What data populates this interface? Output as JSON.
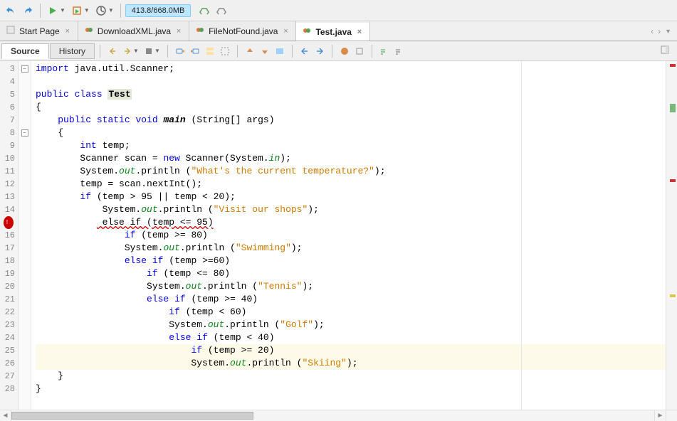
{
  "toolbar": {
    "memory": "413.8/668.0MB"
  },
  "tabs": [
    {
      "label": "Start Page",
      "icon": "start"
    },
    {
      "label": "DownloadXML.java",
      "icon": "java"
    },
    {
      "label": "FileNotFound.java",
      "icon": "java"
    },
    {
      "label": "Test.java",
      "icon": "java"
    }
  ],
  "activeTab": 3,
  "subTabs": {
    "source": "Source",
    "history": "History"
  },
  "code": {
    "lines": [
      {
        "n": 3,
        "fold": "minus",
        "html": "<span class='kw'>import</span> java.util.Scanner;"
      },
      {
        "n": 4,
        "html": ""
      },
      {
        "n": 5,
        "html": "<span class='kw'>public</span> <span class='kw'>class</span> <span class='cls'><b>Test</b></span>"
      },
      {
        "n": 6,
        "html": "{"
      },
      {
        "n": 7,
        "html": "    <span class='kw'>public</span> <span class='kw'>static</span> <span class='kw'>void</span> <span class='fn'>main</span> (String[] args)"
      },
      {
        "n": 8,
        "fold": "minus",
        "html": "    {"
      },
      {
        "n": 9,
        "html": "        <span class='kw'>int</span> temp;"
      },
      {
        "n": 10,
        "html": "        Scanner scan = <span class='kw'>new</span> Scanner(System.<span class='fld'>in</span>);"
      },
      {
        "n": 11,
        "html": "        System.<span class='fld'>out</span>.println (<span class='str'>\"What's the current temperature?\"</span>);"
      },
      {
        "n": 12,
        "html": "        temp = scan.nextInt();"
      },
      {
        "n": 13,
        "html": "        <span class='kw'>if</span> (temp &gt; 95 || temp &lt; 20);"
      },
      {
        "n": 14,
        "html": "            System.<span class='fld'>out</span>.println (<span class='str'>\"Visit our shops\"</span>);"
      },
      {
        "n": "err",
        "html": "           <span class='err'> else if (temp &lt;= 95)</span>"
      },
      {
        "n": 16,
        "html": "                <span class='kw'>if</span> (temp &gt;= 80)"
      },
      {
        "n": 17,
        "html": "                System.<span class='fld'>out</span>.println (<span class='str'>\"Swimming\"</span>);"
      },
      {
        "n": 18,
        "html": "                <span class='kw'>else</span> <span class='kw'>if</span> (temp &gt;=60)"
      },
      {
        "n": 19,
        "html": "                    <span class='kw'>if</span> (temp &lt;= 80)"
      },
      {
        "n": 20,
        "html": "                    System.<span class='fld'>out</span>.println (<span class='str'>\"Tennis\"</span>);"
      },
      {
        "n": 21,
        "html": "                    <span class='kw'>else</span> <span class='kw'>if</span> (temp &gt;= 40)"
      },
      {
        "n": 22,
        "html": "                        <span class='kw'>if</span> (temp &lt; 60)"
      },
      {
        "n": 23,
        "html": "                        System.<span class='fld'>out</span>.println (<span class='str'>\"Golf\"</span>);"
      },
      {
        "n": 24,
        "html": "                        <span class='kw'>else</span> <span class='kw'>if</span> (temp &lt; 40)"
      },
      {
        "n": 25,
        "hl": true,
        "html": "                            <span class='kw'>if</span> (temp &gt;= 20)"
      },
      {
        "n": 26,
        "hl": true,
        "html": "                            System.<span class='fld'>out</span>.println (<span class='str'>\"Skiing\"</span>);"
      },
      {
        "n": 27,
        "html": "    }"
      },
      {
        "n": 28,
        "html": "}"
      }
    ]
  }
}
